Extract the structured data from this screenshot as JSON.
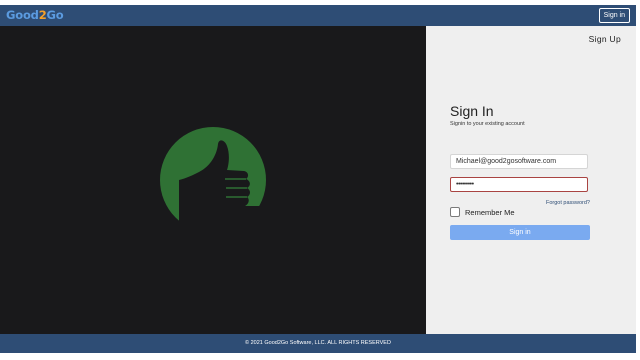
{
  "header": {
    "logo": {
      "part1": "Good",
      "part2": "2",
      "part3": "Go"
    },
    "signin_label": "Sign in"
  },
  "hero": {
    "icon": "thumbs-up-icon",
    "icon_bg_color": "#2f7134"
  },
  "panel": {
    "signup_label": "Sign Up",
    "title": "Sign In",
    "subtitle": "Signin to your existing account",
    "email_value": "Michael@good2gosoftware.com",
    "password_value": "•••••••••",
    "forgot_label": "Forgot password?",
    "remember_label": "Remember Me",
    "submit_label": "Sign in"
  },
  "footer": {
    "text": "© 2021 Good2Go Software, LLC. ALL RIGHTS RESERVED"
  },
  "colors": {
    "header_bg": "#2e4d75",
    "hero_bg": "#19191b",
    "button_bg": "#7aaaf0",
    "password_border": "#a94442"
  }
}
